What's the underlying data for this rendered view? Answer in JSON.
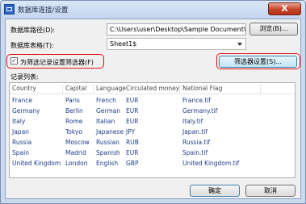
{
  "window": {
    "title": "数据库连接/设置",
    "close_label": "X"
  },
  "form": {
    "db_path_label": "数据库路径(D):",
    "db_path_value": "C:\\Users\\user\\Desktop\\Sample Document\\Sa",
    "browse_label": "浏览(B)...",
    "db_table_label": "数据库表格(T):",
    "db_table_value": "Sheet1$",
    "filter_checkbox_label": "为筛选记录设置筛选器(F)",
    "filter_checked": true,
    "filter_button_label": "筛选器设置(S)...",
    "record_list_label": "记录列表:"
  },
  "table": {
    "columns": [
      "Country",
      "Capital",
      "Language",
      "Circulated money",
      "National Flag"
    ],
    "rows": [
      [
        "France",
        "Paris",
        "French",
        "EUR",
        "France.tif"
      ],
      [
        "Germany",
        "Berlin",
        "German",
        "EUR",
        "Germany.tif"
      ],
      [
        "Italy",
        "Rome",
        "Italian",
        "EUR",
        "Italy.tif"
      ],
      [
        "Japan",
        "Tokyo",
        "Japanese",
        "JPY",
        "Japan.tif"
      ],
      [
        "Russia",
        "Moscow",
        "Russian",
        "RUB",
        "Russia.tif"
      ],
      [
        "Spain",
        "Madrid",
        "Spanish",
        "EUR",
        "Spain.tif"
      ],
      [
        "United Kingdom",
        "London",
        "English",
        "GBP",
        "United Kingdom.tif"
      ]
    ]
  },
  "footer": {
    "ok_label": "确定",
    "cancel_label": "取消"
  }
}
